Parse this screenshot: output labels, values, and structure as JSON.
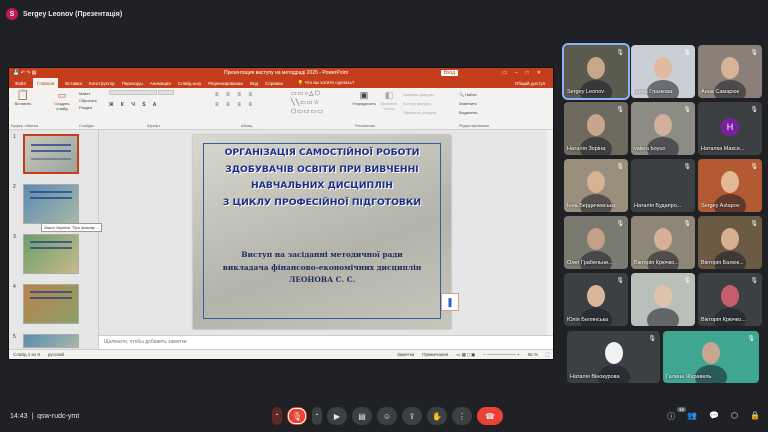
{
  "meeting": {
    "presenter_initial": "S",
    "presenter_label": "Sergey Leonov (Презентація)",
    "time": "14:43",
    "code": "qsw-rudc-ymt",
    "participant_count": "16"
  },
  "ppt": {
    "titlebar": "Презентация виступу на методраді 2025  -  PowerPoint",
    "sign_in": "Вход",
    "tabs": [
      "Файл",
      "Главная",
      "Вставка",
      "Конструктор",
      "Переходы",
      "Анимация",
      "Слайд-шоу",
      "Рецензирование",
      "Вид",
      "Справка"
    ],
    "tell_me": "Что вы хотите сделать?",
    "share": "Общий доступ",
    "groups": {
      "clipboard": "Буфер обмена",
      "slides": "Слайды",
      "font": "Шрифт",
      "paragraph": "Абзац",
      "drawing": "Рисование",
      "editing": "Редактирование"
    },
    "buttons": {
      "paste": "Вставить",
      "create": "Создать слайд",
      "layout": "Макет",
      "reset": "Сбросить",
      "section": "Раздел",
      "arrange": "Упорядочить",
      "express": "Экспресс-стили",
      "fill": "Заливка фигуры",
      "outline": "Контур фигуры",
      "effects": "Эффекты фигуры",
      "find": "Найти",
      "replace": "Заменить",
      "select": "Выделить"
    },
    "tooltip": "Закон України \"Про фахову ...",
    "slide_title_lines": [
      "ОРГАНІЗАЦІЯ САМОСТІЙНОЇ РОБОТИ",
      "ЗДОБУВАЧІВ ОСВІТИ ПРИ ВИВЧЕННІ",
      "НАВЧАЛЬНИХ ДИСЦИПЛІН",
      "З ЦИКЛУ ПРОФЕСІЙНОЇ ПІДГОТОВКИ"
    ],
    "slide_sub_lines": [
      "Виступ на засіданні методичної ради",
      "викладача фінансово-економічних дисциплін",
      "ЛЕОНОВА С. С."
    ],
    "thumb_numbers": [
      "1",
      "2",
      "3",
      "4",
      "5"
    ],
    "notes": "Щелкните, чтобы добавить заметки",
    "status_slide": "Слайд 1 из 9",
    "status_lang": "русский",
    "status_notes": "Заметки",
    "status_comments": "Примечания",
    "zoom": "65 %"
  },
  "participants": [
    {
      "name": "Sergey Leonov",
      "bg": "#5a5a4e",
      "skin": "#c9a68a"
    },
    {
      "name": "Ірина Глазкова",
      "bg": "#c9cfd4",
      "skin": "#e0b9a0"
    },
    {
      "name": "Анна Самарюк",
      "bg": "#8a8077",
      "skin": "#d9b29a"
    },
    {
      "name": "Наталія Зоріна",
      "bg": "#6e6a60",
      "skin": "#c8a48c"
    },
    {
      "name": "valera boyuo",
      "bg": "#8c8c84",
      "skin": "#d2b09a"
    },
    {
      "name": "Наталка Макси...",
      "bg": "#3c4043",
      "initial": "H"
    },
    {
      "name": "Інна Бердичевська",
      "bg": "#9a8f7c",
      "skin": "#d6b192"
    },
    {
      "name": "Наталія Будапро...",
      "bg": "#3c4043"
    },
    {
      "name": "Sergey Astapov",
      "bg": "#b45a32",
      "skin": "#e3b895"
    },
    {
      "name": "Олег Грабельни...",
      "bg": "#7a7a70",
      "skin": "#c3a088"
    },
    {
      "name": "Вікторія Крючко...",
      "bg": "#8e8676",
      "skin": "#d6b196"
    },
    {
      "name": "Вікторія Балюк...",
      "bg": "#6b5a44",
      "skin": "#d7b08f"
    },
    {
      "name": "Юлія Белянська",
      "bg": "#3c4043",
      "skin": "#d8b69c"
    },
    {
      "name": "",
      "bg": "#b9bfb9",
      "skin": "#e1c2aa"
    },
    {
      "name": "Вікторія Крючко...",
      "bg": "#3c4043",
      "skin": "#c45d6e"
    },
    {
      "name": "Наталія Вінокурова",
      "bg": "#3c4043",
      "skin": "#f1f1f1"
    },
    {
      "name": "Галина Журавель",
      "bg": "#3ea691",
      "skin": "#caa690"
    }
  ]
}
